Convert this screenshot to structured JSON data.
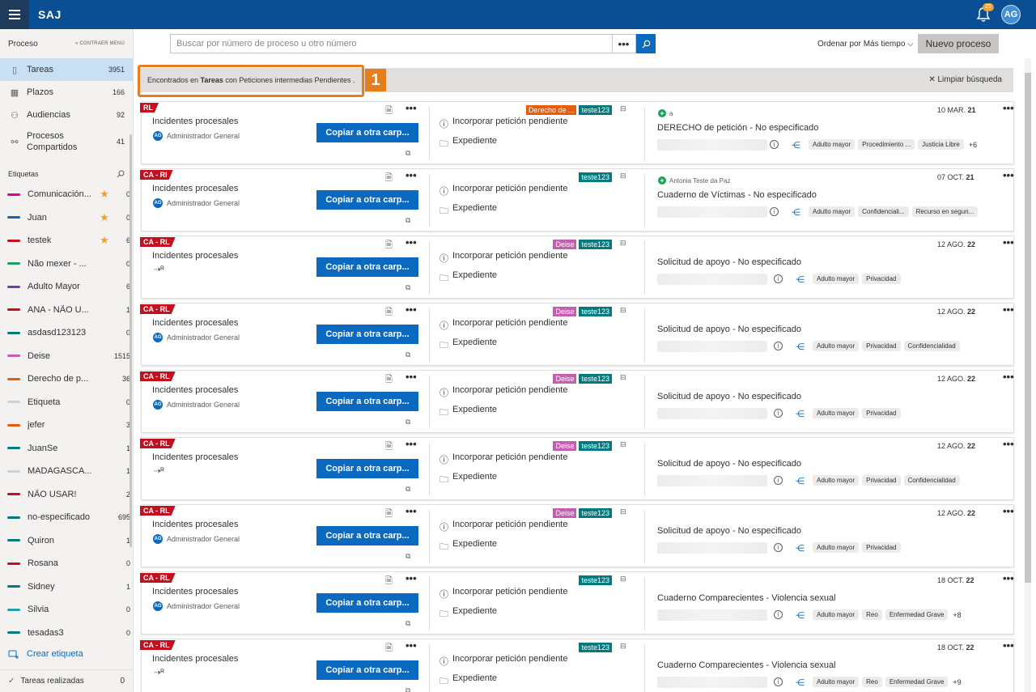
{
  "header": {
    "app_name": "SAJ",
    "notifications_count": "25",
    "user_initials": "AG"
  },
  "sidebar": {
    "section_title": "Proceso",
    "collapse_label": "« CONTRAER MENÚ",
    "nav": [
      {
        "label": "Tareas",
        "count": "3951",
        "icon": "tasks-icon"
      },
      {
        "label": "Plazos",
        "count": "166",
        "icon": "calendar-icon"
      },
      {
        "label": "Audiencias",
        "count": "92",
        "icon": "people-icon"
      },
      {
        "label": "Procesos Compartidos",
        "count": "41",
        "icon": "shared-icon"
      }
    ],
    "tags_title": "Etiquetas",
    "tags": [
      {
        "label": "Comunicación...",
        "count": "0",
        "color": "#e3008c",
        "star": true
      },
      {
        "label": "Juan",
        "count": "0",
        "color": "#0b6abf",
        "star": true
      },
      {
        "label": "testek",
        "count": "6",
        "color": "#c50f1f",
        "star": true
      },
      {
        "label": "Não mexer - ...",
        "count": "0",
        "color": "#16a05a",
        "star": false
      },
      {
        "label": "Adulto Mayor",
        "count": "6",
        "color": "#6b3fb8",
        "star": false
      },
      {
        "label": "ANA - NÃO U...",
        "count": "1",
        "color": "#c50f1f",
        "star": false
      },
      {
        "label": "asdasd123123",
        "count": "0",
        "color": "#037a7e",
        "star": false
      },
      {
        "label": "Deise",
        "count": "1515",
        "color": "#c45fb0",
        "star": false
      },
      {
        "label": "Derecho de p...",
        "count": "36",
        "color": "#e65d0c",
        "star": false
      },
      {
        "label": "Etiqueta",
        "count": "0",
        "color": "#d0d0d0",
        "star": false
      },
      {
        "label": "jefer",
        "count": "3",
        "color": "#e65d0c",
        "star": false
      },
      {
        "label": "JuanSe",
        "count": "1",
        "color": "#037a7e",
        "star": false
      },
      {
        "label": "MADAGASCA...",
        "count": "1",
        "color": "#d0d0d0",
        "star": false
      },
      {
        "label": "NÃO USAR!",
        "count": "2",
        "color": "#c50f1f",
        "star": false
      },
      {
        "label": "no-especificado",
        "count": "695",
        "color": "#037a7e",
        "star": false
      },
      {
        "label": "Quiron",
        "count": "1",
        "color": "#037a7e",
        "star": false
      },
      {
        "label": "Rosana",
        "count": "0",
        "color": "#c50f1f",
        "star": false
      },
      {
        "label": "Sidney",
        "count": "1",
        "color": "#037a7e",
        "star": false
      },
      {
        "label": "Silvia",
        "count": "0",
        "color": "#20a0a8",
        "star": false
      },
      {
        "label": "tesadas3",
        "count": "0",
        "color": "#037a7e",
        "star": false
      }
    ],
    "create_tag": "Crear etiqueta",
    "done_tasks": {
      "label": "Tareas realizadas",
      "count": "0"
    }
  },
  "search": {
    "placeholder": "Buscar por número de proceso u otro número",
    "more": "•••"
  },
  "sort": {
    "prefix": "Ordenar por",
    "value": "Más tiempo"
  },
  "new_button": "Nuevo proceso",
  "banner": {
    "pre": "Encontrados en ",
    "bold": "Tareas",
    "post": " con Peticiones intermedias Pendientes .",
    "clear": "Limpiar búsqueda",
    "annotation": "1"
  },
  "cards": [
    {
      "flag": "RL",
      "type": "Incidentes procesales",
      "assignee": "Administrador General",
      "copy": "Copiar a otra carp...",
      "action": "Incorporar petición pendiente",
      "folder": "Expediente",
      "tags": [
        {
          "label": "Derecho de ...",
          "color": "#e65d0c"
        },
        {
          "label": "teste123",
          "color": "#037a7e"
        }
      ],
      "creator": "a",
      "date_day": "10 MAR.",
      "date_year": "21",
      "title": "DERECHO de petición - No especificado",
      "chips": [
        "Adulto mayor",
        "Procedimiento ...",
        "Justicia Libre"
      ],
      "more": "+6"
    },
    {
      "flag": "CA - RI",
      "type": "Incidentes procesales",
      "assignee": "Administrador General",
      "copy": "Copiar a otra carp...",
      "action": "Incorporar petición pendiente",
      "folder": "Expediente",
      "tags": [
        {
          "label": "teste123",
          "color": "#037a7e"
        }
      ],
      "creator": "Antonia Teste da Paz",
      "date_day": "07 OCT.",
      "date_year": "21",
      "title": "Cuaderno de Víctimas - No especificado",
      "chips": [
        "Adulto mayor",
        "Confidenciali...",
        "Recurso en segun..."
      ],
      "more": ""
    },
    {
      "flag": "CA - RL",
      "type": "Incidentes procesales",
      "assignee": "",
      "copy": "Copiar a otra carp...",
      "action": "Incorporar petición pendiente",
      "folder": "Expediente",
      "tags": [
        {
          "label": "Deise",
          "color": "#c45fb0"
        },
        {
          "label": "teste123",
          "color": "#037a7e"
        }
      ],
      "creator": "",
      "date_day": "12 AGO.",
      "date_year": "22",
      "title": "Solicitud de apoyo - No especificado",
      "chips": [
        "Adulto mayor",
        "Privacidad"
      ],
      "more": ""
    },
    {
      "flag": "CA - RL",
      "type": "Incidentes procesales",
      "assignee": "Administrador General",
      "copy": "Copiar a otra carp...",
      "action": "Incorporar petición pendiente",
      "folder": "Expediente",
      "tags": [
        {
          "label": "Deise",
          "color": "#c45fb0"
        },
        {
          "label": "teste123",
          "color": "#037a7e"
        }
      ],
      "creator": "",
      "date_day": "12 AGO.",
      "date_year": "22",
      "title": "Solicitud de apoyo - No especificado",
      "chips": [
        "Adulto mayor",
        "Privacidad",
        "Confidencialidad"
      ],
      "more": ""
    },
    {
      "flag": "CA - RL",
      "type": "Incidentes procesales",
      "assignee": "Administrador General",
      "copy": "Copiar a otra carp...",
      "action": "Incorporar petición pendiente",
      "folder": "Expediente",
      "tags": [
        {
          "label": "Deise",
          "color": "#c45fb0"
        },
        {
          "label": "teste123",
          "color": "#037a7e"
        }
      ],
      "creator": "",
      "date_day": "12 AGO.",
      "date_year": "22",
      "title": "Solicitud de apoyo - No especificado",
      "chips": [
        "Adulto mayor",
        "Privacidad"
      ],
      "more": ""
    },
    {
      "flag": "CA - RL",
      "type": "Incidentes procesales",
      "assignee": "",
      "copy": "Copiar a otra carp...",
      "action": "Incorporar petición pendiente",
      "folder": "Expediente",
      "tags": [
        {
          "label": "Deise",
          "color": "#c45fb0"
        },
        {
          "label": "teste123",
          "color": "#037a7e"
        }
      ],
      "creator": "",
      "date_day": "12 AGO.",
      "date_year": "22",
      "title": "Solicitud de apoyo - No especificado",
      "chips": [
        "Adulto mayor",
        "Privacidad",
        "Confidencialidad"
      ],
      "more": ""
    },
    {
      "flag": "CA - RL",
      "type": "Incidentes procesales",
      "assignee": "Administrador General",
      "copy": "Copiar a otra carp...",
      "action": "Incorporar petición pendiente",
      "folder": "Expediente",
      "tags": [
        {
          "label": "Deise",
          "color": "#c45fb0"
        },
        {
          "label": "teste123",
          "color": "#037a7e"
        }
      ],
      "creator": "",
      "date_day": "12 AGO.",
      "date_year": "22",
      "title": "Solicitud de apoyo - No especificado",
      "chips": [
        "Adulto mayor",
        "Privacidad"
      ],
      "more": ""
    },
    {
      "flag": "CA - RL",
      "type": "Incidentes procesales",
      "assignee": "Administrador General",
      "copy": "Copiar a otra carp...",
      "action": "Incorporar petición pendiente",
      "folder": "Expediente",
      "tags": [
        {
          "label": "teste123",
          "color": "#037a7e"
        }
      ],
      "creator": "",
      "date_day": "18 OCT.",
      "date_year": "22",
      "title": "Cuaderno Comparecientes - Violencia sexual",
      "chips": [
        "Adulto mayor",
        "Reo",
        "Enfermedad Grave"
      ],
      "more": "+8"
    },
    {
      "flag": "CA - RL",
      "type": "Incidentes procesales",
      "assignee": "",
      "copy": "Copiar a otra carp...",
      "action": "Incorporar petición pendiente",
      "folder": "Expediente",
      "tags": [
        {
          "label": "teste123",
          "color": "#037a7e"
        }
      ],
      "creator": "",
      "date_day": "18 OCT.",
      "date_year": "22",
      "title": "Cuaderno Comparecientes - Violencia sexual",
      "chips": [
        "Adulto mayor",
        "Reo",
        "Enfermedad Grave"
      ],
      "more": "+9"
    }
  ]
}
